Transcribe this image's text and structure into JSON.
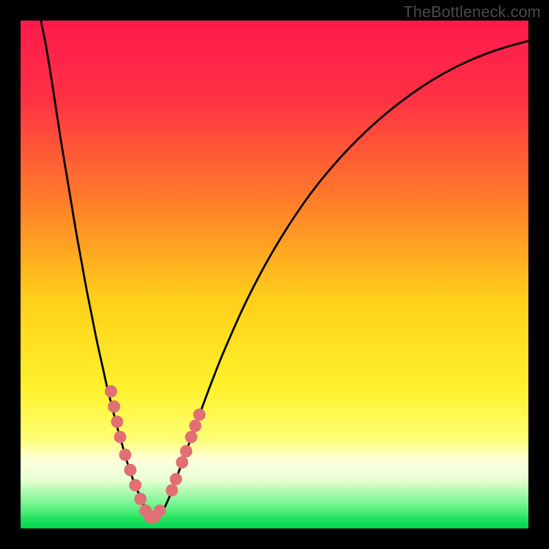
{
  "watermark": "TheBottleneck.com",
  "chart_data": {
    "type": "line",
    "title": "",
    "xlabel": "",
    "ylabel": "",
    "xlim": [
      0,
      100
    ],
    "ylim": [
      0,
      100
    ],
    "gradient_stops": [
      {
        "offset": 0.0,
        "color": "#ff1a4d"
      },
      {
        "offset": 0.15,
        "color": "#ff3044"
      },
      {
        "offset": 0.35,
        "color": "#ff7b2a"
      },
      {
        "offset": 0.55,
        "color": "#ffd01a"
      },
      {
        "offset": 0.72,
        "color": "#fff12a"
      },
      {
        "offset": 0.82,
        "color": "#ffff70"
      },
      {
        "offset": 0.845,
        "color": "#ffffa8"
      },
      {
        "offset": 0.855,
        "color": "#ffffc8"
      },
      {
        "offset": 0.87,
        "color": "#fcffdc"
      },
      {
        "offset": 0.905,
        "color": "#e8ffd2"
      },
      {
        "offset": 0.955,
        "color": "#6cf58a"
      },
      {
        "offset": 0.985,
        "color": "#18e05a"
      },
      {
        "offset": 1.0,
        "color": "#00d850"
      }
    ],
    "series": [
      {
        "name": "bottleneck-curve",
        "x": [
          4,
          5,
          6,
          7,
          8,
          9,
          10,
          11,
          12,
          13,
          14,
          15,
          16,
          17,
          18,
          19,
          20,
          21,
          22,
          23,
          24,
          25,
          25.5,
          26,
          27,
          28,
          29,
          30,
          32,
          34,
          36,
          38,
          40,
          44,
          48,
          52,
          56,
          60,
          65,
          70,
          75,
          80,
          85,
          90,
          95,
          100
        ],
        "y": [
          100,
          95,
          89,
          82.5,
          76,
          70,
          64,
          58,
          52.5,
          47,
          42,
          37,
          32.5,
          28,
          24,
          20,
          16.5,
          13,
          10,
          7.5,
          5.2,
          3.0,
          2.2,
          2.0,
          2.3,
          3.5,
          5.5,
          8.0,
          13.5,
          19.0,
          24.5,
          29.8,
          34.8,
          43.8,
          51.6,
          58.4,
          64.4,
          69.6,
          75.2,
          80.0,
          84.1,
          87.6,
          90.5,
          92.8,
          94.6,
          96.0
        ]
      }
    ],
    "markers": {
      "name": "highlight-dots",
      "color": "#e26f73",
      "points": [
        {
          "x": 17.8,
          "y": 27.0
        },
        {
          "x": 18.4,
          "y": 24.0
        },
        {
          "x": 19.0,
          "y": 21.0
        },
        {
          "x": 19.6,
          "y": 18.0
        },
        {
          "x": 20.6,
          "y": 14.5
        },
        {
          "x": 21.6,
          "y": 11.5
        },
        {
          "x": 22.6,
          "y": 8.5
        },
        {
          "x": 23.6,
          "y": 5.8
        },
        {
          "x": 24.6,
          "y": 3.5
        },
        {
          "x": 25.5,
          "y": 2.2
        },
        {
          "x": 26.4,
          "y": 2.3
        },
        {
          "x": 27.4,
          "y": 3.5
        },
        {
          "x": 29.8,
          "y": 7.5
        },
        {
          "x": 30.6,
          "y": 9.7
        },
        {
          "x": 31.8,
          "y": 13.0
        },
        {
          "x": 32.6,
          "y": 15.2
        },
        {
          "x": 33.6,
          "y": 18.0
        },
        {
          "x": 34.4,
          "y": 20.2
        },
        {
          "x": 35.2,
          "y": 22.4
        }
      ]
    }
  }
}
